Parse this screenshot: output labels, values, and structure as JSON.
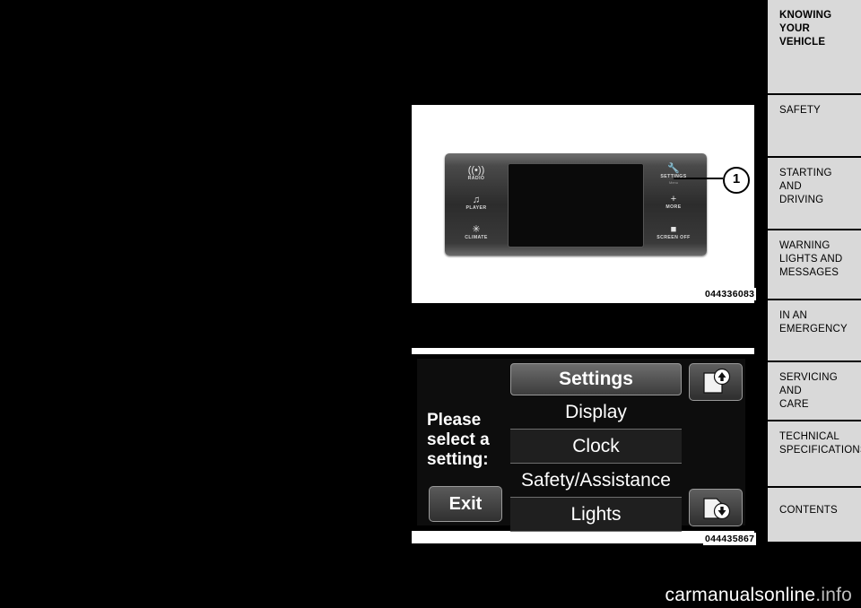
{
  "page": {
    "background": "#000000",
    "watermark": "carmanualsonline.info",
    "watermark_main": "carmanualsonline",
    "watermark_suffix": ".info"
  },
  "tabs": [
    {
      "name": "knowing-your-vehicle",
      "lines": [
        "KNOWING",
        "YOUR",
        "VEHICLE"
      ],
      "bold": true
    },
    {
      "name": "safety",
      "lines": [
        "SAFETY"
      ],
      "bold": false
    },
    {
      "name": "starting-and-driving",
      "lines": [
        "STARTING",
        "AND",
        "DRIVING"
      ],
      "bold": false
    },
    {
      "name": "warning-lights-and-messages",
      "lines": [
        "WARNING",
        "LIGHTS AND",
        "MESSAGES"
      ],
      "bold": false
    },
    {
      "name": "in-an-emergency",
      "lines": [
        "IN AN",
        "EMERGENCY"
      ],
      "bold": false
    },
    {
      "name": "servicing-and-care",
      "lines": [
        "SERVICING",
        "AND",
        "CARE"
      ],
      "bold": false
    },
    {
      "name": "technical-specifications",
      "lines": [
        "TECHNICAL",
        "SPECIFICATIONS"
      ],
      "bold": false
    },
    {
      "name": "contents",
      "lines": [
        "CONTENTS"
      ],
      "bold": false
    }
  ],
  "figure1": {
    "id": "044336083",
    "callout": "1",
    "buttons": [
      {
        "name": "radio",
        "caption": "RADIO",
        "sub": "",
        "glyph": "(•)"
      },
      {
        "name": "player",
        "caption": "PLAYER",
        "sub": "",
        "glyph": "♫"
      },
      {
        "name": "climate",
        "caption": "CLIMATE",
        "sub": "",
        "glyph": "✳"
      },
      {
        "name": "settings",
        "caption": "SETTINGS",
        "sub": "Menu",
        "glyph": "⚙"
      },
      {
        "name": "more",
        "caption": "MORE",
        "sub": "",
        "glyph": "+"
      },
      {
        "name": "screen-off",
        "caption": "SCREEN OFF",
        "sub": "",
        "glyph": "■"
      }
    ]
  },
  "figure2": {
    "id": "044435867",
    "prompt": "Please select a setting:",
    "prompt_lines": [
      "Please",
      "select a",
      "setting:"
    ],
    "exit_label": "Exit",
    "header_label": "Settings",
    "menu_items": [
      {
        "name": "display",
        "label": "Display"
      },
      {
        "name": "clock",
        "label": "Clock"
      },
      {
        "name": "safety-assistance",
        "label": "Safety/Assistance"
      },
      {
        "name": "lights",
        "label": "Lights"
      }
    ],
    "scroll_up_icon": "scroll-up-icon",
    "scroll_down_icon": "scroll-down-icon"
  }
}
